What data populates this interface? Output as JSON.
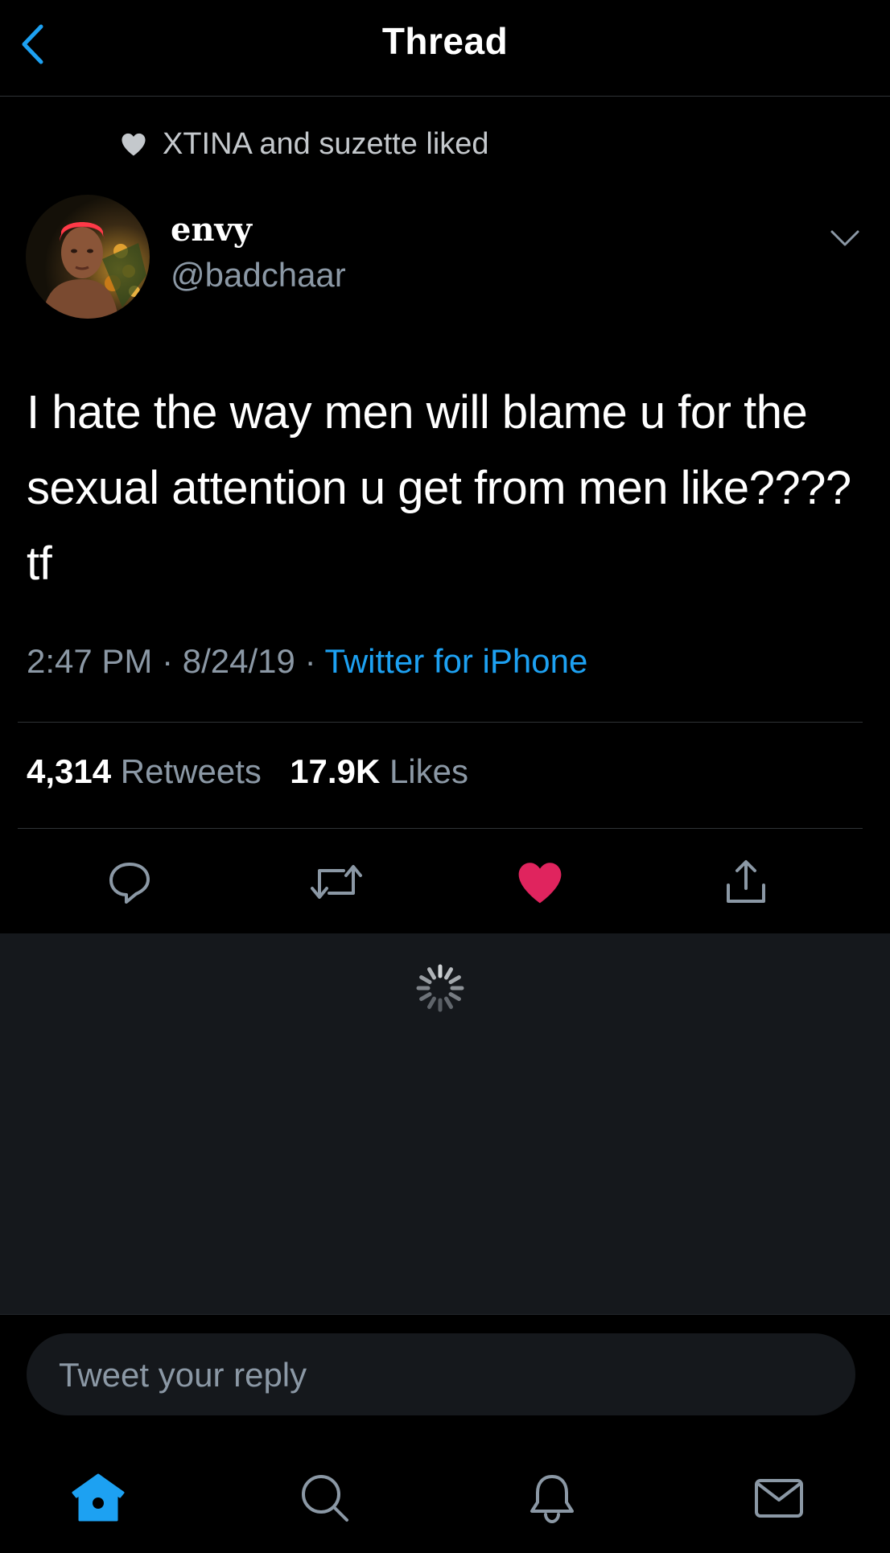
{
  "header": {
    "title": "Thread"
  },
  "social_context": {
    "text": "XTINA and suzette liked"
  },
  "author": {
    "display_name": "envy",
    "handle": "@badchaar"
  },
  "tweet": {
    "text": "I hate the way men will blame u for the sexual attention u get from men like???? tf",
    "time": "2:47 PM",
    "date": "8/24/19",
    "separator": "·",
    "source": "Twitter for iPhone"
  },
  "stats": {
    "retweets_count": "4,314",
    "retweets_label": "Retweets",
    "likes_count": "17.9K",
    "likes_label": "Likes"
  },
  "actions": {
    "liked": true,
    "like_color": "#e0245e"
  },
  "reply": {
    "placeholder": "Tweet your reply"
  },
  "tabs": {
    "active": "home",
    "accent": "#1da1f2"
  },
  "colors": {
    "accent": "#1da1f2",
    "secondary_text": "#8b98a5",
    "background": "#000000"
  }
}
